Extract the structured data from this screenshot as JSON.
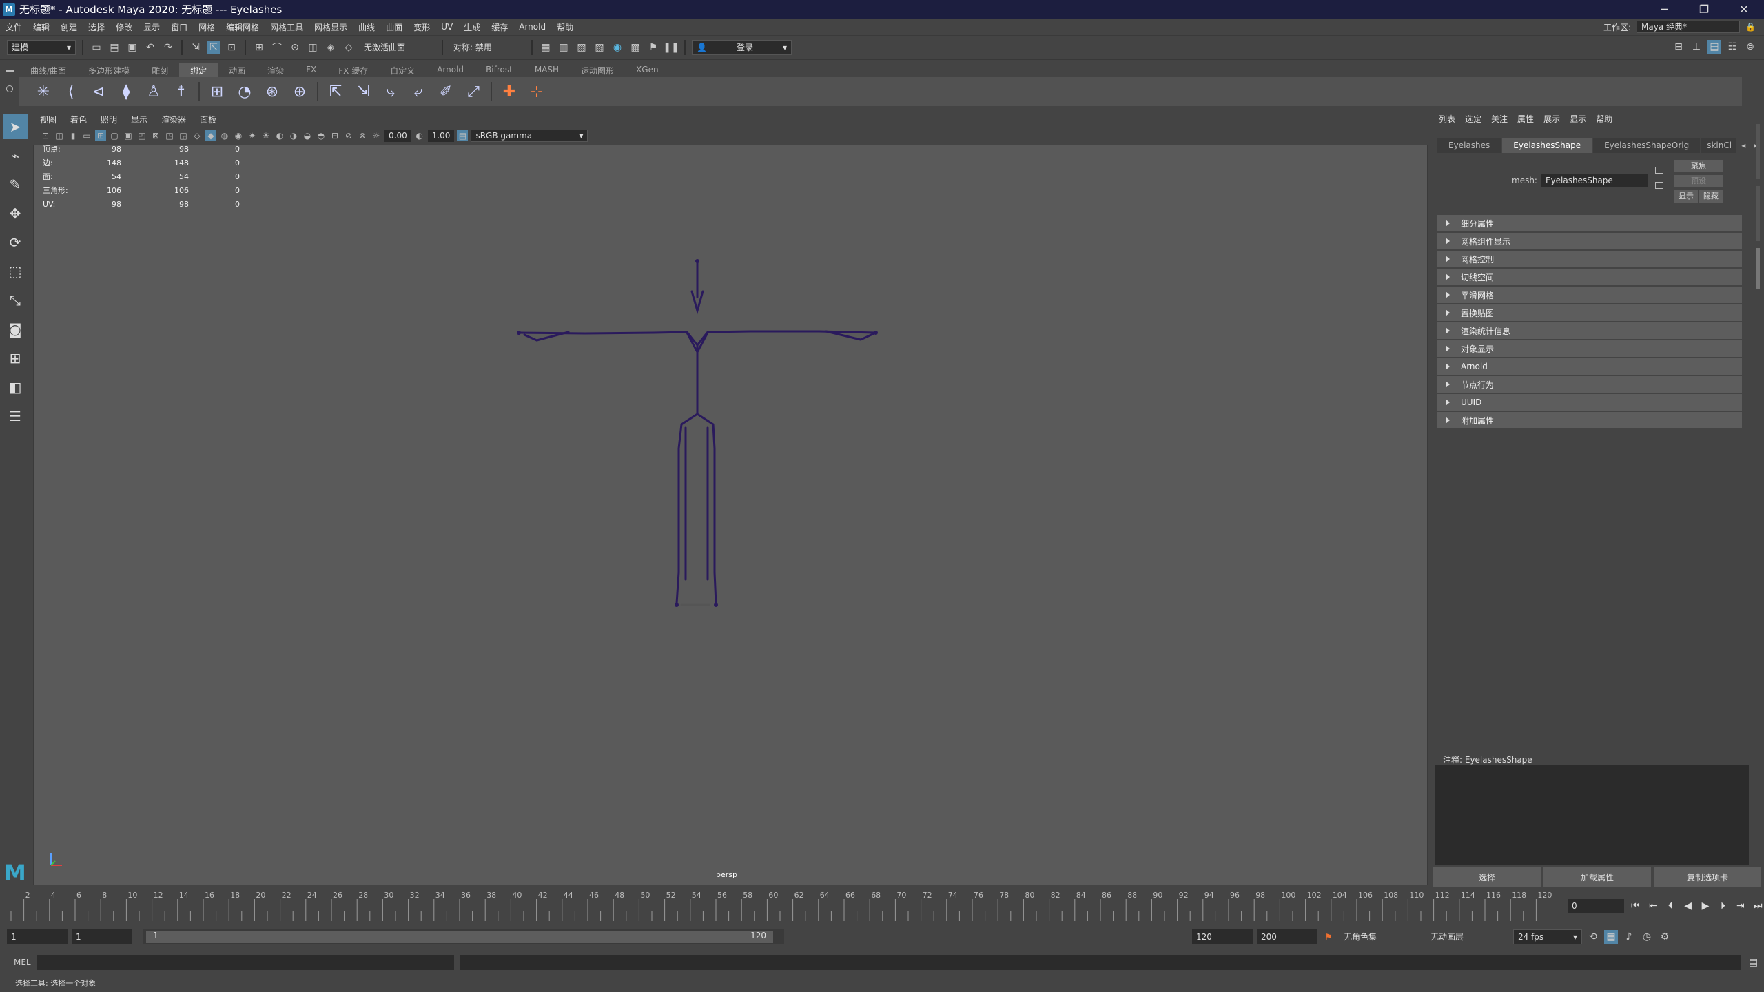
{
  "window": {
    "title": "无标题* - Autodesk Maya 2020: 无标题   ---   Eyelashes",
    "logo": "M"
  },
  "menubar": {
    "items": [
      "文件",
      "编辑",
      "创建",
      "选择",
      "修改",
      "显示",
      "窗口",
      "网格",
      "编辑网格",
      "网格工具",
      "网格显示",
      "曲线",
      "曲面",
      "变形",
      "UV",
      "生成",
      "缓存",
      "Arnold",
      "帮助"
    ],
    "workspace_label": "工作区:",
    "workspace_value": "Maya 经典*"
  },
  "statusline": {
    "mode": "建模",
    "live_surface": "无激活曲面",
    "symmetry": "对称: 禁用",
    "login": "登录"
  },
  "shelf": {
    "tabs": [
      "曲线/曲面",
      "多边形建模",
      "雕刻",
      "绑定",
      "动画",
      "渲染",
      "FX",
      "FX 缓存",
      "自定义",
      "Arnold",
      "Bifrost",
      "MASH",
      "运动图形",
      "XGen"
    ],
    "active_tab": "绑定"
  },
  "viewport": {
    "menus": [
      "视图",
      "着色",
      "照明",
      "显示",
      "渲染器",
      "面板"
    ],
    "exposure": "0.00",
    "gamma": "1.00",
    "colorspace": "sRGB gamma",
    "camera": "persp",
    "hud": [
      {
        "label": "顶点:",
        "a": "98",
        "b": "98",
        "c": "0"
      },
      {
        "label": "边:",
        "a": "148",
        "b": "148",
        "c": "0"
      },
      {
        "label": "面:",
        "a": "54",
        "b": "54",
        "c": "0"
      },
      {
        "label": "三角形:",
        "a": "106",
        "b": "106",
        "c": "0"
      },
      {
        "label": "UV:",
        "a": "98",
        "b": "98",
        "c": "0"
      }
    ]
  },
  "attribute_editor": {
    "menus": [
      "列表",
      "选定",
      "关注",
      "属性",
      "展示",
      "显示",
      "帮助"
    ],
    "tabs": [
      "Eyelashes",
      "EyelashesShape",
      "EyelashesShapeOrig",
      "skinCl"
    ],
    "active_tab": "EyelashesShape",
    "mesh_label": "mesh:",
    "mesh_value": "EyelashesShape",
    "focus_btn": "聚焦",
    "preset_btn": "预设",
    "show_btn": "显示",
    "hide_btn": "隐藏",
    "sections": [
      "细分属性",
      "网格组件显示",
      "网格控制",
      "切线空间",
      "平滑网格",
      "置换贴图",
      "渲染统计信息",
      "对象显示",
      "Arnold",
      "节点行为",
      "UUID",
      "附加属性"
    ],
    "notes_label": "注释:  EyelashesShape",
    "buttons": [
      "选择",
      "加载属性",
      "复制选项卡"
    ]
  },
  "timeslider": {
    "ticks": [
      "2",
      "4",
      "6",
      "8",
      "10",
      "12",
      "14",
      "16",
      "18",
      "20",
      "22",
      "24",
      "26",
      "28",
      "30",
      "32",
      "34",
      "36",
      "38",
      "40",
      "42",
      "44",
      "46",
      "48",
      "50",
      "52",
      "54",
      "56",
      "58",
      "60",
      "62",
      "64",
      "66",
      "68",
      "70",
      "72",
      "74",
      "76",
      "78",
      "80",
      "82",
      "84",
      "86",
      "88",
      "90",
      "92",
      "94",
      "96",
      "98",
      "100",
      "102",
      "104",
      "106",
      "108",
      "110",
      "112",
      "114",
      "116",
      "118",
      "120"
    ],
    "current_frame": "0"
  },
  "rangeslider": {
    "start": "1",
    "anim_start": "1",
    "range_start_label": "1",
    "range_end_label": "120",
    "end": "120",
    "anim_end": "200",
    "character_set": "无角色集",
    "anim_layer": "无动画层",
    "fps": "24 fps"
  },
  "cmdline": {
    "label": "MEL"
  },
  "helpline": {
    "text": "选择工具: 选择一个对象"
  }
}
